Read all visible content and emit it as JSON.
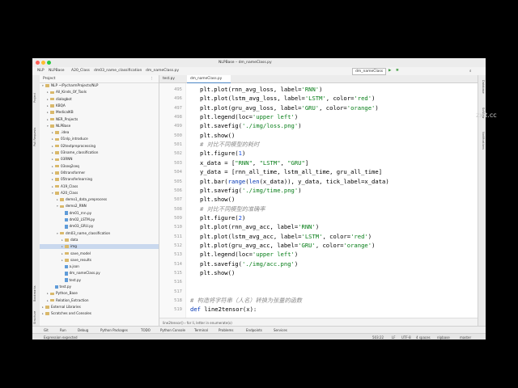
{
  "window": {
    "title": "NLPBase – dm_nameClass.py"
  },
  "nav": {
    "crumbs": [
      "NLP",
      "NLPBase",
      "A20_Class",
      "dm03_name_classification",
      "dm_nameClass.py"
    ],
    "run_config": "dm_nameClass",
    "run_label": "▶",
    "debug_label": "✱"
  },
  "left_strip": {
    "tabs": [
      "Project",
      "Pull Requests",
      "Bookmarks",
      "Structure"
    ]
  },
  "right_strip": {
    "tabs": [
      "Database",
      "SciView",
      "Notifications"
    ]
  },
  "project": {
    "header": "Project",
    "rows": [
      {
        "label": "NLP  ~/PycharmProjects/NLP",
        "kind": "folder",
        "depth": 0,
        "open": true
      },
      {
        "label": "All_Kinds_Of_Tools",
        "kind": "folder",
        "depth": 1,
        "open": false
      },
      {
        "label": "dialogbot",
        "kind": "folder",
        "depth": 1,
        "open": false
      },
      {
        "label": "KBQA",
        "kind": "folder",
        "depth": 1,
        "open": false
      },
      {
        "label": "MedicalKB",
        "kind": "folder",
        "depth": 1,
        "open": false
      },
      {
        "label": "NER_Projects",
        "kind": "folder",
        "depth": 1,
        "open": false
      },
      {
        "label": "NLPBase",
        "kind": "folder",
        "depth": 1,
        "open": true
      },
      {
        "label": ".idea",
        "kind": "folder",
        "depth": 2,
        "open": false
      },
      {
        "label": "01nlp_introduce",
        "kind": "folder",
        "depth": 2,
        "open": false
      },
      {
        "label": "02textpreprocessing",
        "kind": "folder",
        "depth": 2,
        "open": false
      },
      {
        "label": "03name_classification",
        "kind": "folder",
        "depth": 2,
        "open": false
      },
      {
        "label": "03RNN",
        "kind": "folder",
        "depth": 2,
        "open": false
      },
      {
        "label": "03seq2seq",
        "kind": "folder",
        "depth": 2,
        "open": false
      },
      {
        "label": "04transformer",
        "kind": "folder",
        "depth": 2,
        "open": false
      },
      {
        "label": "05transferlearning",
        "kind": "folder",
        "depth": 2,
        "open": false
      },
      {
        "label": "A19_Class",
        "kind": "folder",
        "depth": 2,
        "open": false
      },
      {
        "label": "A20_Class",
        "kind": "folder",
        "depth": 2,
        "open": true
      },
      {
        "label": "demo1_data_preprocess",
        "kind": "folder",
        "depth": 3,
        "open": false
      },
      {
        "label": "demo2_RNN",
        "kind": "folder",
        "depth": 3,
        "open": true
      },
      {
        "label": "dm01_rnn.py",
        "kind": "file",
        "depth": 4
      },
      {
        "label": "dm02_LSTM.py",
        "kind": "file",
        "depth": 4
      },
      {
        "label": "dm03_GRU.py",
        "kind": "file",
        "depth": 4
      },
      {
        "label": "dm03_name_classification",
        "kind": "folder",
        "depth": 3,
        "open": true
      },
      {
        "label": "data",
        "kind": "folder",
        "depth": 4,
        "open": false
      },
      {
        "label": "img",
        "kind": "folder",
        "depth": 4,
        "open": false,
        "selected": true
      },
      {
        "label": "save_model",
        "kind": "folder",
        "depth": 4,
        "open": false
      },
      {
        "label": "save_results",
        "kind": "folder",
        "depth": 4,
        "open": false
      },
      {
        "label": "a.json",
        "kind": "file",
        "depth": 4
      },
      {
        "label": "dm_nameClass.py",
        "kind": "file",
        "depth": 4
      },
      {
        "label": "test.py",
        "kind": "file",
        "depth": 4
      },
      {
        "label": "test.py",
        "kind": "file",
        "depth": 2
      },
      {
        "label": "Python_Base",
        "kind": "folder",
        "depth": 1,
        "open": false
      },
      {
        "label": "Relation_Extraction",
        "kind": "folder",
        "depth": 1,
        "open": false
      },
      {
        "label": "External Libraries",
        "kind": "folder",
        "depth": 0,
        "open": false
      },
      {
        "label": "Scratches and Consoles",
        "kind": "folder",
        "depth": 0,
        "open": false
      }
    ]
  },
  "editor": {
    "tabs": [
      "test.py",
      "dm_nameClass.py"
    ],
    "active_tab": 1,
    "lines": [
      {
        "n": "495",
        "html": "plt.plot(rnn_avg_loss, label=<span class=\"str\">'RNN'</span>)"
      },
      {
        "n": "496",
        "html": "plt.plot(lstm_avg_loss, label=<span class=\"str\">'LSTM'</span>, color=<span class=\"str\">'red'</span>)"
      },
      {
        "n": "497",
        "html": "plt.plot(gru_avg_loss, label=<span class=\"str\">'GRU'</span>, color=<span class=\"str\">'orange'</span>)"
      },
      {
        "n": "498",
        "html": "plt.legend(loc=<span class=\"str\">'upper left'</span>)"
      },
      {
        "n": "499",
        "html": "plt.savefig(<span class=\"str\">'./img/loss.png'</span>)"
      },
      {
        "n": "500",
        "html": "plt.show()"
      },
      {
        "n": "501",
        "html": "<span class=\"cmt\"># 对比不同模型的耗时</span>"
      },
      {
        "n": "502",
        "html": "plt.figure(<span class=\"num\">1</span>)"
      },
      {
        "n": "503",
        "html": "x_data = [<span class=\"str\">\"RNN\"</span>, <span class=\"str\">\"LSTM\"</span>, <span class=\"str\">\"GRU\"</span>]"
      },
      {
        "n": "504",
        "html": "y_data = [rnn_all_time, lstm_all_time, gru_all_time]"
      },
      {
        "n": "505",
        "html": "plt.bar(<span class=\"kw\">range</span>(<span class=\"kw\">len</span>(x_data)), y_data, tick_label=x_data)"
      },
      {
        "n": "506",
        "html": "plt.savefig(<span class=\"str\">'./img/time.png'</span>)"
      },
      {
        "n": "507",
        "html": "plt.show()"
      },
      {
        "n": "508",
        "html": "<span class=\"cmt\"># 对比不同模型的准确率</span>"
      },
      {
        "n": "509",
        "html": "plt.figure(<span class=\"num\">2</span>)"
      },
      {
        "n": "510",
        "html": "plt.plot(rnn_avg_acc, label=<span class=\"str\">'RNN'</span>)"
      },
      {
        "n": "511",
        "html": "plt.plot(lstm_avg_acc, label=<span class=\"str\">'LSTM'</span>, color=<span class=\"str\">'red'</span>)"
      },
      {
        "n": "512",
        "html": "plt.plot(gru_avg_acc, label=<span class=\"str\">'GRU'</span>, color=<span class=\"str\">'orange'</span>)"
      },
      {
        "n": "513",
        "html": "plt.legend(loc=<span class=\"str\">'upper left'</span>)"
      },
      {
        "n": "514",
        "html": "plt.savefig(<span class=\"str\">'./img/acc.png'</span>)"
      },
      {
        "n": "515",
        "html": "plt.show()"
      },
      {
        "n": "516",
        "html": ""
      },
      {
        "n": "517",
        "html": ""
      },
      {
        "n": "518",
        "html": "<span class=\"cmt\"># 构造将字符串（人名）转换为张量的函数</span>"
      },
      {
        "n": "519",
        "html": "<span class=\"kw\">def</span> line2tensor(x):"
      }
    ],
    "bottom_breadcrumb": "line2tensor()  ›  for li, letter in enumerate(x)"
  },
  "toolbar": {
    "items": [
      "Git",
      "Run",
      "Debug",
      "Python Packages",
      "TODO",
      "Python Console",
      "Terminal",
      "Problems",
      "Endpoints",
      "Services"
    ]
  },
  "status": {
    "left": "Expression expected",
    "right": [
      "503:22",
      "LF",
      "UTF-8",
      "4 spaces",
      "nlpbase",
      "master"
    ]
  },
  "watermark": "zxit.cc",
  "colors": {
    "accent": "#4a86c5",
    "selection": "#c9d8ee",
    "string": "#067d17",
    "keyword": "#0033b3",
    "comment": "#8c8c8c"
  }
}
